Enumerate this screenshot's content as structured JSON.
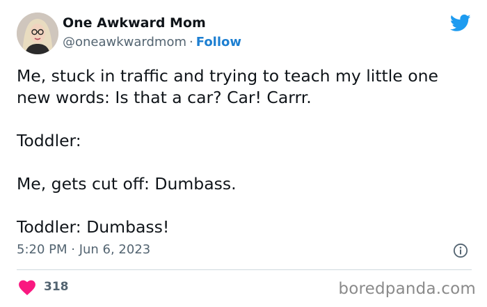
{
  "author": {
    "display_name": "One Awkward Mom",
    "handle": "@oneawkwardmom",
    "separator": "·",
    "follow_label": "Follow"
  },
  "tweet": {
    "paragraphs": [
      "Me, stuck in traffic and trying to teach my little one new words: Is that a car? Car! Carrr.",
      "Toddler:",
      "Me, gets cut off: Dumbass.",
      "Toddler: Dumbass!"
    ],
    "timestamp": "5:20 PM · Jun 6, 2023"
  },
  "engagement": {
    "likes": "318"
  },
  "watermark": "boredpanda.com",
  "icons": {
    "brand": "twitter-bird-icon",
    "info": "info-icon",
    "like": "heart-icon"
  },
  "colors": {
    "twitter_blue": "#1d9bf0",
    "follow_blue": "#1d7fd1",
    "heart_pink": "#f91880",
    "muted_text": "#536471"
  }
}
